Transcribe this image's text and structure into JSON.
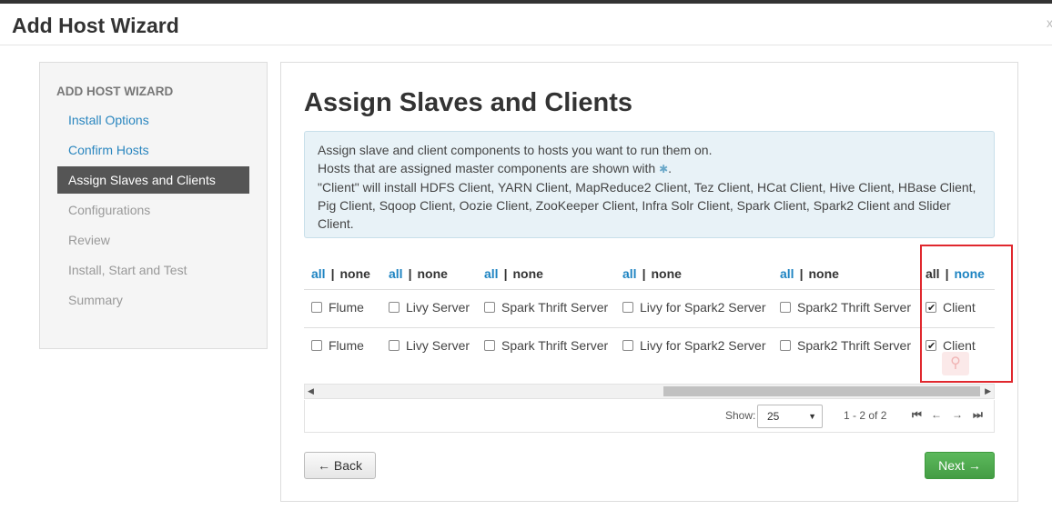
{
  "modal": {
    "title": "Add Host Wizard",
    "close": "x"
  },
  "sidebar": {
    "heading": "ADD HOST WIZARD",
    "items": [
      {
        "label": "Install Options",
        "state": "link"
      },
      {
        "label": "Confirm Hosts",
        "state": "link"
      },
      {
        "label": "Assign Slaves and Clients",
        "state": "active"
      },
      {
        "label": "Configurations",
        "state": "disabled"
      },
      {
        "label": "Review",
        "state": "disabled"
      },
      {
        "label": "Install, Start and Test",
        "state": "disabled"
      },
      {
        "label": "Summary",
        "state": "disabled"
      }
    ]
  },
  "main": {
    "title": "Assign Slaves and Clients",
    "alert": {
      "line1": "Assign slave and client components to hosts you want to run them on.",
      "line2_prefix": "Hosts that are assigned master components are shown with",
      "line2_suffix": ".",
      "line3": "\"Client\" will install HDFS Client, YARN Client, MapReduce2 Client, Tez Client, HCat Client, Hive Client, HBase Client, Pig Client, Sqoop Client, Oozie Client, ZooKeeper Client, Infra Solr Client, Spark Client, Spark2 Client and Slider Client."
    },
    "columns": [
      {
        "all": "all",
        "sep": "|",
        "none": "none"
      },
      {
        "all": "all",
        "sep": "|",
        "none": "none"
      },
      {
        "all": "all",
        "sep": "|",
        "none": "none"
      },
      {
        "all": "all",
        "sep": "|",
        "none": "none"
      },
      {
        "all": "all",
        "sep": "|",
        "none": "none"
      },
      {
        "all": "all",
        "sep": "|",
        "none": "none"
      }
    ],
    "rows": [
      {
        "cells": [
          {
            "label": "Flume",
            "checked": false
          },
          {
            "label": "Livy Server",
            "checked": false
          },
          {
            "label": "Spark Thrift Server",
            "checked": false
          },
          {
            "label": "Livy for Spark2 Server",
            "checked": false
          },
          {
            "label": "Spark2 Thrift Server",
            "checked": false
          },
          {
            "label": "Client",
            "checked": true
          }
        ]
      },
      {
        "cells": [
          {
            "label": "Flume",
            "checked": false
          },
          {
            "label": "Livy Server",
            "checked": false
          },
          {
            "label": "Spark Thrift Server",
            "checked": false
          },
          {
            "label": "Livy for Spark2 Server",
            "checked": false
          },
          {
            "label": "Spark2 Thrift Server",
            "checked": false
          },
          {
            "label": "Client",
            "checked": true
          }
        ]
      }
    ],
    "pager": {
      "show_label": "Show:",
      "page_size": "25",
      "range": "1 - 2 of 2"
    },
    "buttons": {
      "back": "← Back",
      "next": "Next →"
    }
  },
  "colors": {
    "accent": "#2a86bf",
    "next_button": "#5cb85c",
    "highlight": "#e0282e"
  }
}
